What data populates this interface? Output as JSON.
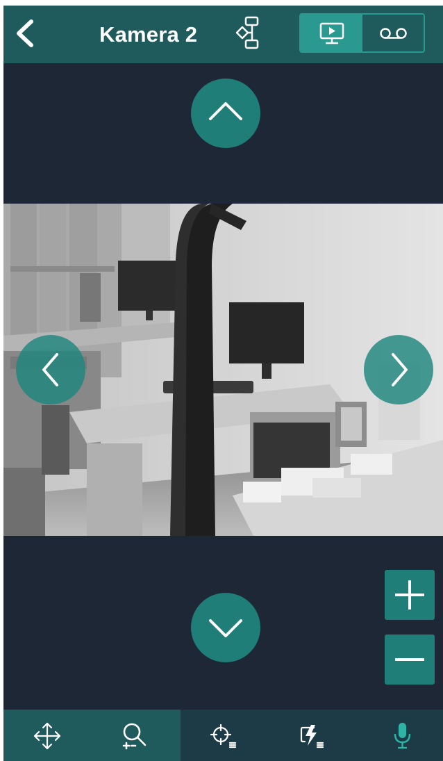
{
  "header": {
    "title": "Kamera 2",
    "back_icon": "chevron-left-icon",
    "tree_icon": "hierarchy-icon",
    "mode_tabs": [
      {
        "icon": "monitor-play-icon",
        "selected": true
      },
      {
        "icon": "voicemail-icon",
        "selected": false
      }
    ]
  },
  "ptz": {
    "up_icon": "chevron-up-icon",
    "down_icon": "chevron-down-icon",
    "left_icon": "chevron-left-icon",
    "right_icon": "chevron-right-icon",
    "zoom_in_icon": "plus-icon",
    "zoom_out_icon": "minus-icon"
  },
  "toolbar": {
    "items": [
      {
        "icon": "move-arrows-icon"
      },
      {
        "icon": "zoom-magnifier-icon"
      },
      {
        "icon": "crosshair-preset-icon"
      },
      {
        "icon": "flash-list-icon"
      },
      {
        "icon": "microphone-icon"
      }
    ]
  },
  "colors": {
    "background": "#1d2735",
    "header": "#1f5b5c",
    "accent": "#2a9a90",
    "button": "#1f7e77",
    "mic": "#2fb3a6"
  }
}
